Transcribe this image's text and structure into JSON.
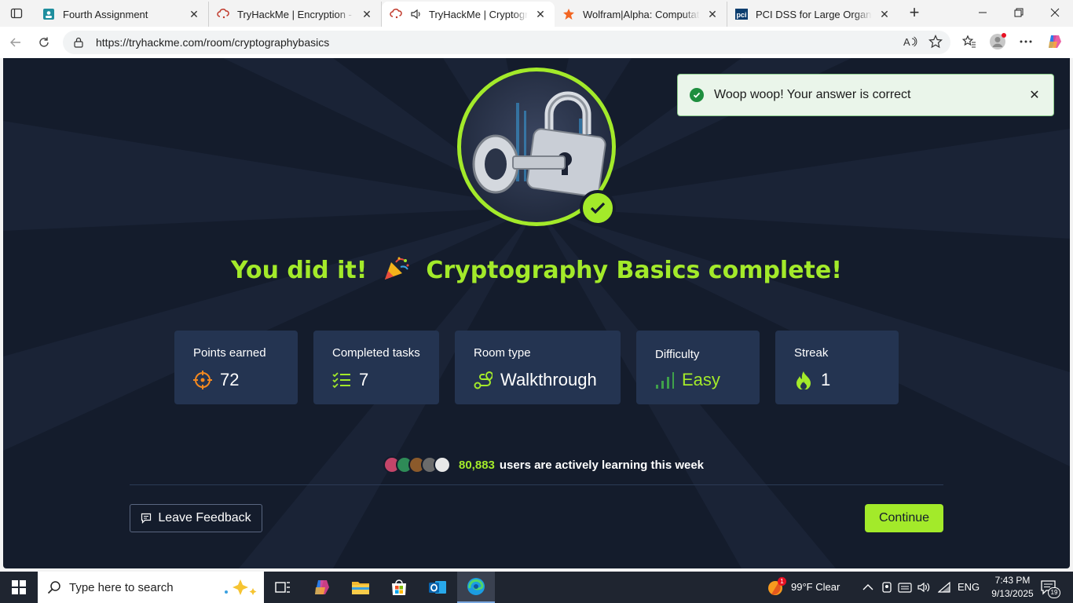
{
  "browser": {
    "tabs": [
      {
        "title": "Fourth Assignment",
        "icon": "classroom-icon"
      },
      {
        "title": "TryHackMe | Encryption - Cryp",
        "icon": "tryhackme-icon"
      },
      {
        "title": "TryHackMe | Cryptograph",
        "icon": "tryhackme-icon",
        "active": true,
        "audio": true
      },
      {
        "title": "Wolfram|Alpha: Computationa",
        "icon": "wolfram-icon"
      },
      {
        "title": "PCI DSS for Large Organizatio",
        "icon": "pci-icon"
      }
    ],
    "url": "https://tryhackme.com/room/cryptographybasics"
  },
  "toast": {
    "message": "Woop woop! Your answer is correct",
    "color": "#1e8e3e"
  },
  "completion": {
    "headline_start": "You did it!",
    "headline_end": "Cryptography Basics complete!",
    "accent": "#a3ea2a"
  },
  "stats": [
    {
      "label": "Points earned",
      "value": "72",
      "icon": "target-icon"
    },
    {
      "label": "Completed tasks",
      "value": "7",
      "icon": "checklist-icon"
    },
    {
      "label": "Room type",
      "value": "Walkthrough",
      "icon": "route-icon"
    },
    {
      "label": "Difficulty",
      "value": "Easy",
      "icon": "signal-bars-icon"
    },
    {
      "label": "Streak",
      "value": "1",
      "icon": "flame-icon"
    }
  ],
  "learners": {
    "count": "80,883",
    "text": "users are actively learning this week"
  },
  "actions": {
    "feedback": "Leave Feedback",
    "continue": "Continue"
  },
  "taskbar": {
    "search_placeholder": "Type here to search",
    "weather": "99°F  Clear",
    "language": "ENG",
    "time": "7:43 PM",
    "date": "9/13/2025",
    "notification_count": "19",
    "weather_badge": "1"
  }
}
